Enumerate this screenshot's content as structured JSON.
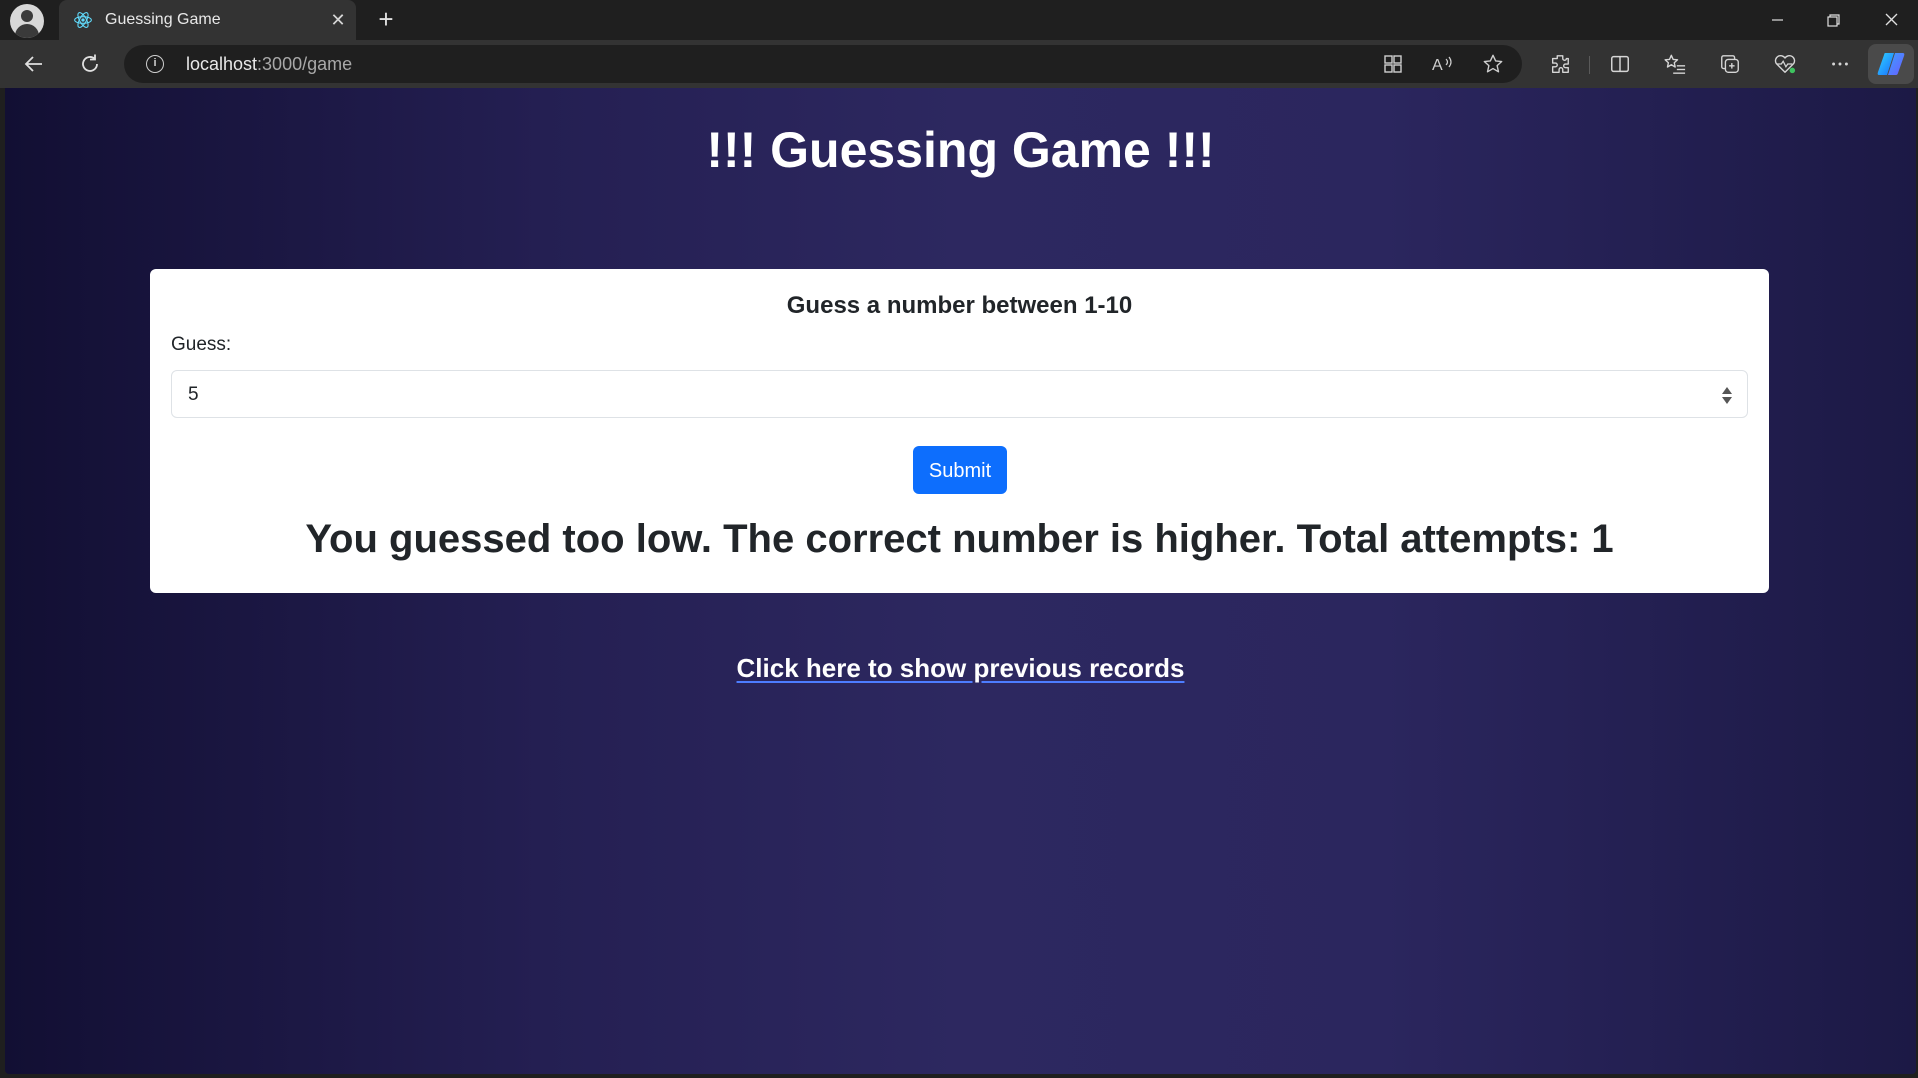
{
  "browser": {
    "tab_title": "Guessing Game",
    "url_host": "localhost",
    "url_path": ":3000/game"
  },
  "page": {
    "title": "!!! Guessing Game !!!",
    "card": {
      "heading": "Guess a number between 1-10",
      "guess_label": "Guess:",
      "guess_value": "5",
      "submit_label": "Submit",
      "result": "You guessed too low. The correct number is higher. Total attempts: 1"
    },
    "records_link": "Click here to show previous records"
  },
  "colors": {
    "primary_button": "#0d6efd",
    "background_gradient_start": "#120f33",
    "background_gradient_mid": "#2d2860"
  },
  "icons": [
    "profile-avatar",
    "react-icon",
    "close-icon",
    "plus-icon",
    "back-icon",
    "refresh-icon",
    "info-icon",
    "app-grid-icon",
    "read-aloud-icon",
    "favorite-star-icon",
    "extensions-icon",
    "split-screen-icon",
    "favorites-icon",
    "collections-icon",
    "performance-icon",
    "more-icon",
    "copilot-icon",
    "minimize-icon",
    "restore-icon"
  ]
}
